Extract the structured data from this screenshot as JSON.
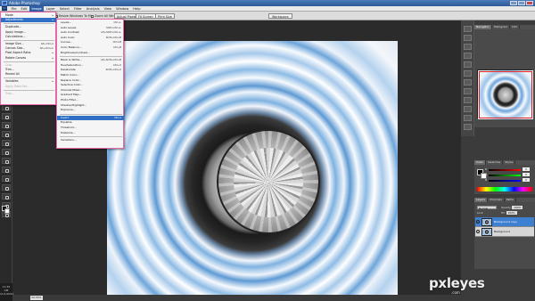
{
  "app": {
    "title": "Adobe Photoshop",
    "document_tab": "Untitled",
    "doc_title": "Background copy, RGB/8"
  },
  "menubar": {
    "items": [
      "File",
      "Edit",
      "Image",
      "Layer",
      "Select",
      "Filter",
      "Analysis",
      "View",
      "Window",
      "Help"
    ],
    "active": "Image"
  },
  "options": {
    "resize_windows": "Resize Windows To Fit",
    "zoom_all_windows": "Zoom All Windows",
    "actual_pixels": "Actual Pixels",
    "fit_screen": "Fit Screen",
    "print_size": "Print Size",
    "workspace": "Workspace"
  },
  "image_menu": {
    "items": [
      {
        "label": "Mode",
        "shortcut": "▸",
        "state": "normal"
      },
      {
        "label": "Adjustments",
        "shortcut": "▸",
        "state": "highlight"
      },
      {
        "label": "Duplicate...",
        "shortcut": "",
        "state": "normal"
      },
      {
        "label": "Apply Image...",
        "shortcut": "",
        "state": "normal"
      },
      {
        "label": "Calculations...",
        "shortcut": "",
        "state": "normal"
      },
      {
        "label": "Image Size...",
        "shortcut": "Alt+Ctrl+I",
        "state": "normal"
      },
      {
        "label": "Canvas Size...",
        "shortcut": "Alt+Ctrl+C",
        "state": "normal"
      },
      {
        "label": "Pixel Aspect Ratio",
        "shortcut": "▸",
        "state": "normal"
      },
      {
        "label": "Rotate Canvas",
        "shortcut": "▸",
        "state": "normal"
      },
      {
        "label": "Crop",
        "shortcut": "",
        "state": "disabled"
      },
      {
        "label": "Trim...",
        "shortcut": "",
        "state": "normal"
      },
      {
        "label": "Reveal All",
        "shortcut": "",
        "state": "normal"
      },
      {
        "label": "Variables",
        "shortcut": "▸",
        "state": "normal"
      },
      {
        "label": "Apply Data Set...",
        "shortcut": "",
        "state": "disabled"
      },
      {
        "label": "Trap...",
        "shortcut": "",
        "state": "disabled"
      }
    ]
  },
  "adjustments_menu": {
    "items": [
      {
        "label": "Levels...",
        "shortcut": "Ctrl+L"
      },
      {
        "label": "Auto Levels",
        "shortcut": "Shift+Ctrl+L"
      },
      {
        "label": "Auto Contrast",
        "shortcut": "Alt+Shift+Ctrl+L"
      },
      {
        "label": "Auto Color",
        "shortcut": "Shift+Ctrl+B"
      },
      {
        "label": "Curves...",
        "shortcut": "Ctrl+M"
      },
      {
        "label": "Color Balance...",
        "shortcut": "Ctrl+B"
      },
      {
        "label": "Brightness/Contrast...",
        "shortcut": ""
      },
      {
        "label": "Black & White...",
        "shortcut": "Alt+Shift+Ctrl+B"
      },
      {
        "label": "Hue/Saturation...",
        "shortcut": "Ctrl+U"
      },
      {
        "label": "Desaturate",
        "shortcut": "Shift+Ctrl+U"
      },
      {
        "label": "Match Color...",
        "shortcut": ""
      },
      {
        "label": "Replace Color...",
        "shortcut": ""
      },
      {
        "label": "Selective Color...",
        "shortcut": ""
      },
      {
        "label": "Channel Mixer...",
        "shortcut": ""
      },
      {
        "label": "Gradient Map...",
        "shortcut": ""
      },
      {
        "label": "Photo Filter...",
        "shortcut": ""
      },
      {
        "label": "Shadow/Highlight...",
        "shortcut": ""
      },
      {
        "label": "Exposure...",
        "shortcut": ""
      },
      {
        "label": "Invert",
        "shortcut": "Ctrl+I",
        "highlight": true
      },
      {
        "label": "Equalize",
        "shortcut": ""
      },
      {
        "label": "Threshold...",
        "shortcut": ""
      },
      {
        "label": "Posterize...",
        "shortcut": ""
      },
      {
        "label": "Variations...",
        "shortcut": ""
      }
    ]
  },
  "navigator": {
    "tabs": [
      "Navigator",
      "Histogram",
      "Info"
    ]
  },
  "color_panel": {
    "tabs": [
      "Color",
      "Swatches",
      "Styles"
    ],
    "channels": [
      {
        "label": "R",
        "value": "0"
      },
      {
        "label": "G",
        "value": "0"
      },
      {
        "label": "B",
        "value": "0"
      }
    ]
  },
  "layers_panel": {
    "tabs": [
      "Layers",
      "Channels",
      "Paths"
    ],
    "blend_mode": "Normal",
    "opacity_label": "Opacity:",
    "opacity": "100%",
    "lock_label": "Lock:",
    "fill_label": "Fill:",
    "fill": "100%",
    "layers": [
      {
        "name": "Background copy",
        "selected": true
      },
      {
        "name": "Background",
        "selected": false
      }
    ]
  },
  "status": {
    "zoom": "33.33%"
  },
  "clock": {
    "time": "11:25 AM",
    "date": "11/1/2011"
  },
  "watermark": {
    "text": "pxleyes",
    "url": ".com"
  },
  "colors": {
    "menu_border": "#e86aa8",
    "highlight": "#2f6fc4",
    "selected_layer": "#3d7fd1"
  }
}
